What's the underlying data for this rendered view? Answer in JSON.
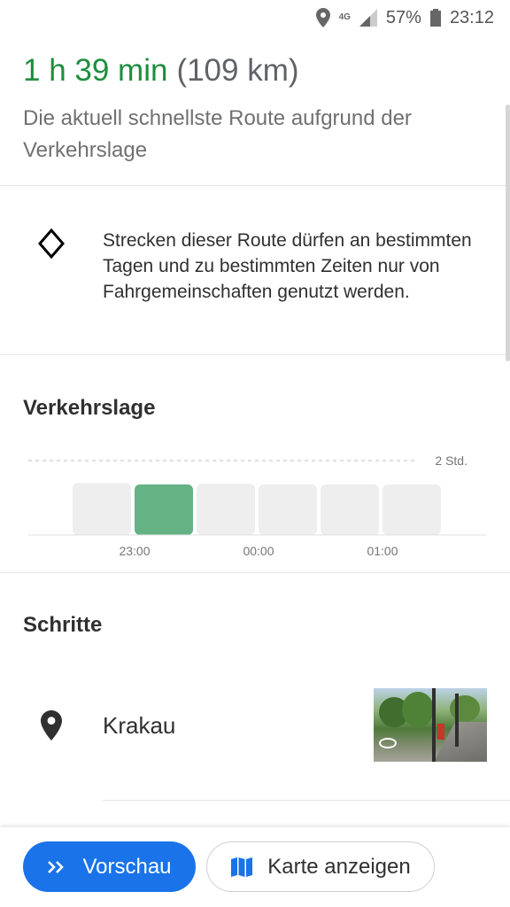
{
  "status_bar": {
    "network": "4G",
    "battery": "57%",
    "time": "23:12",
    "icons": [
      "location-icon",
      "signal-icon",
      "battery-icon"
    ]
  },
  "route": {
    "duration": "1 h 39 min",
    "distance": "(109 km)",
    "description": "Die aktuell schnellste Route aufgrund der Verkehrslage"
  },
  "notice": {
    "icon": "diamond-icon",
    "text": "Strecken dieser Route dürfen an bestimmten Tagen und zu bestimmten Zeiten nur von Fahrgemeinschaften genutzt werden."
  },
  "traffic": {
    "title": "Verkehrslage",
    "chart_data": {
      "type": "bar",
      "categories": [
        "",
        "23:00",
        "",
        "00:00",
        "",
        "01:00"
      ],
      "tick_labels": [
        "23:00",
        "00:00",
        "01:00"
      ],
      "reference_label": "2 Std.",
      "values": [
        1.4,
        1.36,
        1.38,
        1.36,
        1.36,
        1.36
      ],
      "reference_value": 2,
      "highlight_index": 1,
      "colors": {
        "bar": "#eeeeee",
        "highlight": "#65b385",
        "grid": "#bdbdbd"
      }
    }
  },
  "steps": {
    "title": "Schritte",
    "items": [
      {
        "icon": "location-pin-icon",
        "label": "Krakau"
      }
    ]
  },
  "actions": {
    "preview_label": "Vorschau",
    "map_label": "Karte anzeigen"
  },
  "colors": {
    "accent": "#1a73e8",
    "duration": "#1e8e3e"
  }
}
